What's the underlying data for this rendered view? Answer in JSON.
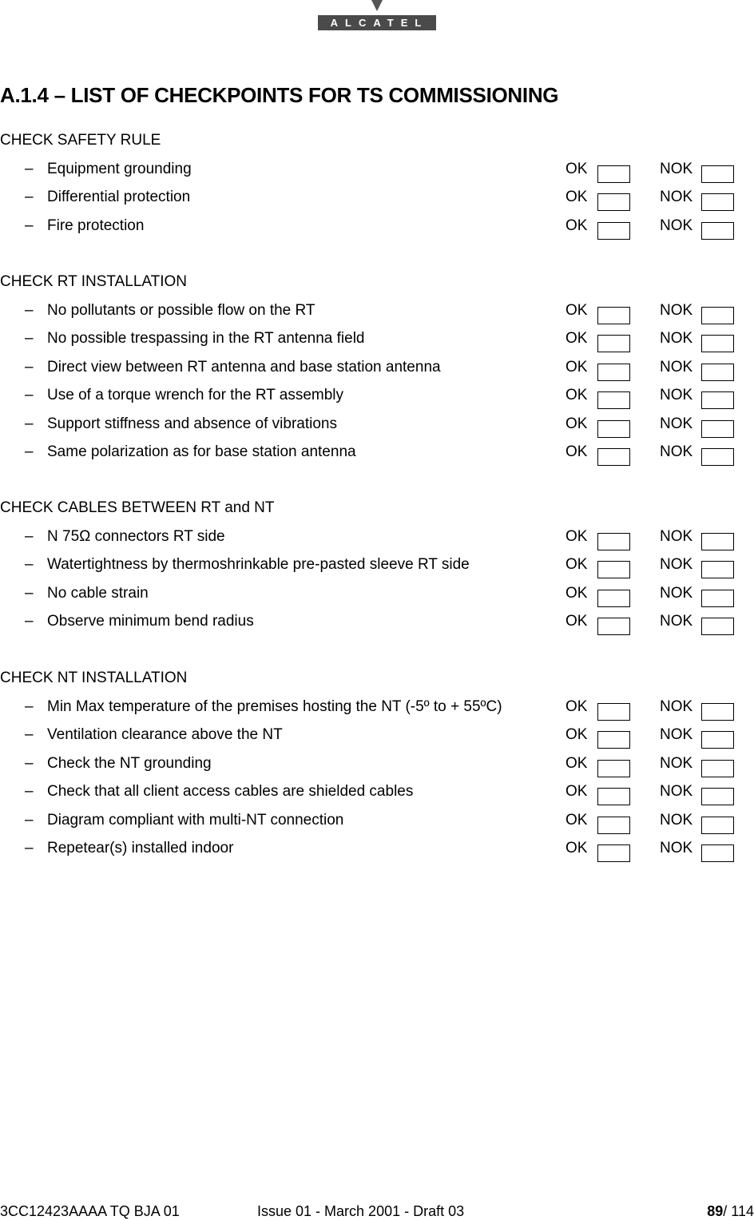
{
  "header": {
    "logo_text": "ALCATEL"
  },
  "title": "A.1.4 – LIST OF CHECKPOINTS FOR TS COMMISSIONING",
  "labels": {
    "ok": "OK",
    "nok": "NOK",
    "dash": "–"
  },
  "sections": [
    {
      "title": "CHECK SAFETY RULE",
      "items": [
        "Equipment grounding",
        "Differential protection",
        "Fire protection"
      ]
    },
    {
      "title": "CHECK RT INSTALLATION",
      "items": [
        "No pollutants or possible flow on the RT",
        "No possible trespassing in the RT antenna field",
        "Direct view between RT antenna and base station antenna",
        "Use of a torque wrench for the RT assembly",
        "Support stiffness and absence of vibrations",
        "Same polarization as for base station antenna"
      ]
    },
    {
      "title": "CHECK CABLES BETWEEN RT and NT",
      "items": [
        "N 75Ω connectors RT side",
        "Watertightness by thermoshrinkable pre-pasted sleeve RT side",
        "No cable strain",
        "Observe minimum bend radius"
      ]
    },
    {
      "title": "CHECK NT INSTALLATION",
      "items": [
        "Min Max temperature of the premises hosting the NT (-5º to + 55ºC)",
        "Ventilation clearance above the NT",
        "Check the NT grounding",
        "Check that all client access cables are shielded cables",
        "Diagram compliant with multi-NT connection",
        "Repetear(s) installed indoor"
      ]
    }
  ],
  "footer": {
    "doc_ref": "3CC12423AAAA TQ BJA 01",
    "issue": "Issue 01 - March 2001 - Draft 03",
    "page_current": "89",
    "page_total": "/ 114"
  }
}
